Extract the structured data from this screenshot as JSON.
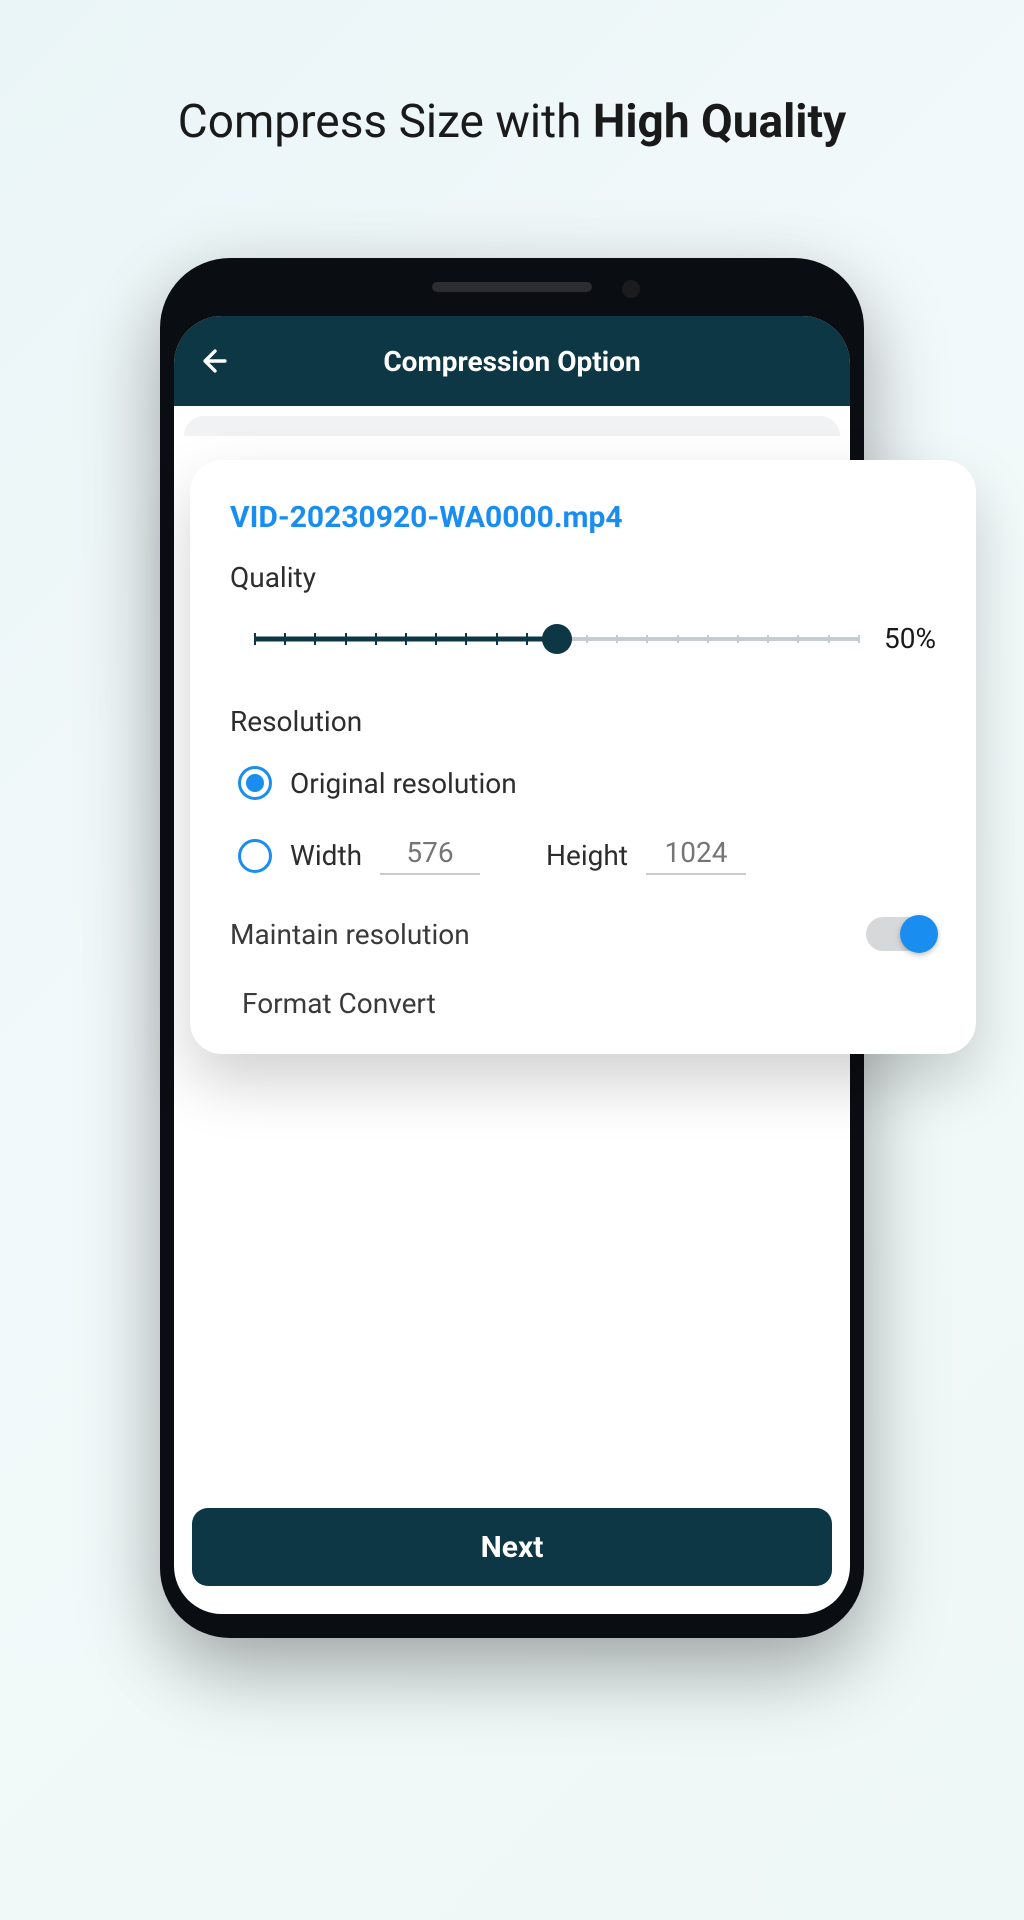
{
  "headline": {
    "prefix": "Compress Size with ",
    "bold": "High Quality"
  },
  "app": {
    "title": "Compression Option"
  },
  "card": {
    "filename": "VID-20230920-WA0000.mp4",
    "quality_label": "Quality",
    "quality_value": "50%",
    "quality_percent": 50,
    "resolution_label": "Resolution",
    "original_option": "Original resolution",
    "width_label": "Width",
    "width_value": "576",
    "height_label": "Height",
    "height_value": "1024",
    "maintain_label": "Maintain resolution",
    "maintain_on": true,
    "format_label": "Format Convert"
  },
  "footer": {
    "next": "Next"
  }
}
